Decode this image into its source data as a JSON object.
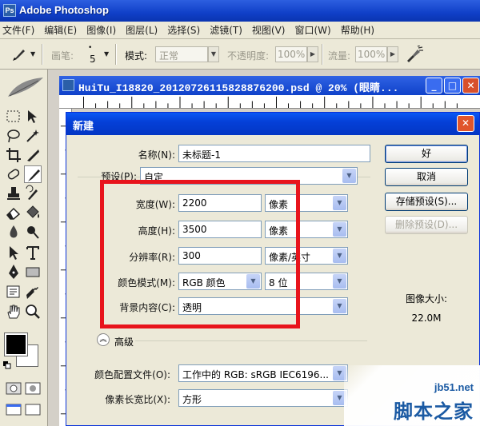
{
  "app": {
    "title": "Adobe Photoshop"
  },
  "menu": [
    "文件(F)",
    "编辑(E)",
    "图像(I)",
    "图层(L)",
    "选择(S)",
    "滤镜(T)",
    "视图(V)",
    "窗口(W)",
    "帮助(H)"
  ],
  "options": {
    "brush_label": "画笔:",
    "brush_size": "5",
    "mode_label": "模式:",
    "mode_value": "正常",
    "opacity_label": "不透明度:",
    "opacity_value": "100%",
    "flow_label": "流量:",
    "flow_value": "100%"
  },
  "document": {
    "title": "HuiTu_I18820_20120726115828876200.psd @ 20% (眼睛..."
  },
  "dialog": {
    "title": "新建",
    "name_label": "名称(N):",
    "name_value": "未标题-1",
    "preset_label": "预设(P):",
    "preset_value": "自定",
    "width_label": "宽度(W):",
    "width_value": "2200",
    "width_unit": "像素",
    "height_label": "高度(H):",
    "height_value": "3500",
    "height_unit": "像素",
    "resolution_label": "分辨率(R):",
    "resolution_value": "300",
    "resolution_unit": "像素/英寸",
    "color_mode_label": "颜色模式(M):",
    "color_mode_value": "RGB 颜色",
    "bit_depth_value": "8 位",
    "background_label": "背景内容(C):",
    "background_value": "透明",
    "advanced_label": "高级",
    "color_profile_label": "颜色配置文件(O):",
    "color_profile_value": "工作中的 RGB: sRGB IEC6196...",
    "pixel_aspect_label": "像素长宽比(X):",
    "pixel_aspect_value": "方形",
    "buttons": {
      "ok": "好",
      "cancel": "取消",
      "save_preset": "存储预设(S)...",
      "delete_preset": "删除预设(D)..."
    },
    "image_size_label": "图像大小:",
    "image_size_value": "22.0M"
  },
  "watermark": {
    "line1": "jb51.net",
    "line2": "脚本之家"
  }
}
